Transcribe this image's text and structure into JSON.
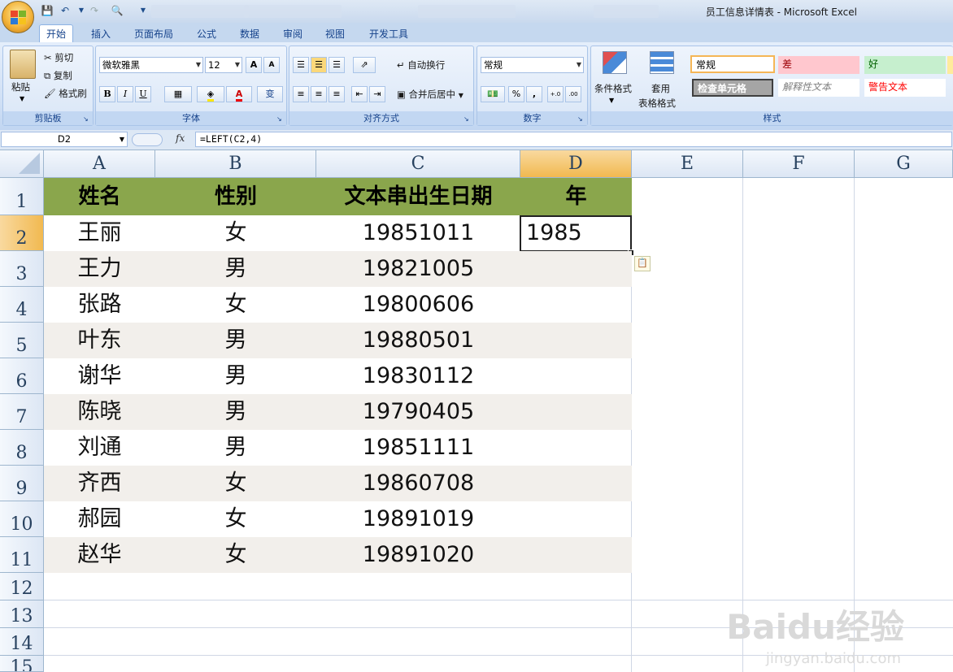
{
  "window": {
    "title": "员工信息详情表 - Microsoft Excel"
  },
  "tabs": [
    "开始",
    "插入",
    "页面布局",
    "公式",
    "数据",
    "审阅",
    "视图",
    "开发工具"
  ],
  "ribbon": {
    "clipboard": {
      "label": "剪贴板",
      "paste": "粘贴",
      "cut": "剪切",
      "copy": "复制",
      "format_painter": "格式刷"
    },
    "font": {
      "label": "字体",
      "font_name": "微软雅黑",
      "font_size": "12",
      "bold": "B",
      "italic": "I",
      "underline": "U",
      "grow": "A",
      "shrink": "A",
      "phonetic": "变"
    },
    "alignment": {
      "label": "对齐方式",
      "wrap": "自动换行",
      "merge": "合并后居中"
    },
    "number": {
      "label": "数字",
      "format": "常规",
      "percent": "%",
      "comma": ",",
      "inc_dec": ".0→.00",
      "dec_dec": ".00→.0"
    },
    "styles": {
      "label": "样式",
      "conditional": "条件格式",
      "table_format_1": "套用",
      "table_format_2": "表格格式",
      "normal": "常规",
      "bad": "差",
      "good": "好",
      "check": "检查单元格",
      "explanatory": "解释性文本",
      "warning": "警告文本"
    }
  },
  "formula_bar": {
    "name_box": "D2",
    "fx": "fx",
    "formula": "=LEFT(C2,4)"
  },
  "columns": [
    "A",
    "B",
    "C",
    "D",
    "E",
    "F",
    "G"
  ],
  "rows": [
    "1",
    "2",
    "3",
    "4",
    "5",
    "6",
    "7",
    "8",
    "9",
    "10",
    "11",
    "12",
    "13",
    "14",
    "15"
  ],
  "table": {
    "headers": [
      "姓名",
      "性别",
      "文本串出生日期",
      "年"
    ],
    "records": [
      {
        "name": "王丽",
        "gender": "女",
        "date": "19851011",
        "year": "1985"
      },
      {
        "name": "王力",
        "gender": "男",
        "date": "19821005",
        "year": ""
      },
      {
        "name": "张路",
        "gender": "女",
        "date": "19800606",
        "year": ""
      },
      {
        "name": "叶东",
        "gender": "男",
        "date": "19880501",
        "year": ""
      },
      {
        "name": "谢华",
        "gender": "男",
        "date": "19830112",
        "year": ""
      },
      {
        "name": "陈晓",
        "gender": "男",
        "date": "19790405",
        "year": ""
      },
      {
        "name": "刘通",
        "gender": "男",
        "date": "19851111",
        "year": ""
      },
      {
        "name": "齐西",
        "gender": "女",
        "date": "19860708",
        "year": ""
      },
      {
        "name": "郝园",
        "gender": "女",
        "date": "19891019",
        "year": ""
      },
      {
        "name": "赵华",
        "gender": "女",
        "date": "19891020",
        "year": ""
      }
    ]
  },
  "colors": {
    "header_fill": "#8aa64c",
    "band_fill": "#f2efeb",
    "selected_header": "#f1b950"
  },
  "watermark": {
    "brand": "Baidu经验",
    "url": "jingyan.baidu.com"
  }
}
